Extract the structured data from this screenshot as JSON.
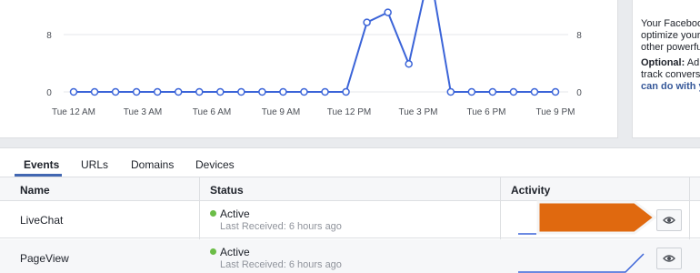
{
  "chart_data": {
    "type": "line",
    "x_ticks": [
      "Tue 12 AM",
      "Tue 3 AM",
      "Tue 6 AM",
      "Tue 9 AM",
      "Tue 12 PM",
      "Tue 3 PM",
      "Tue 6 PM",
      "Tue 9 PM"
    ],
    "y_ticks_left": [
      "8",
      "0"
    ],
    "y_ticks_right": [
      "8",
      "0"
    ],
    "ylim": [
      0,
      16
    ],
    "grid": true,
    "series": [
      {
        "color": "#3b64d8",
        "values": [
          0,
          0,
          0,
          0,
          0,
          0,
          0,
          0,
          0,
          0,
          0,
          0,
          0,
          0,
          9.7,
          11.1,
          3.9,
          17,
          0,
          0,
          0,
          0,
          0,
          0
        ]
      }
    ]
  },
  "side": {
    "lines": [
      "Your Faceboo",
      "optimize your",
      "other powerfu"
    ],
    "optional_label": "Optional:",
    "optional_rest": " Ad",
    "line5": "track conversi",
    "link": "can do with y"
  },
  "tabs": [
    {
      "label": "Events"
    },
    {
      "label": "URLs"
    },
    {
      "label": "Domains"
    },
    {
      "label": "Devices"
    }
  ],
  "columns": {
    "name": "Name",
    "status": "Status",
    "activity": "Activity"
  },
  "rows": [
    {
      "name": "LiveChat",
      "status": "Active",
      "last_received": "Last Received: 6 hours ago"
    },
    {
      "name": "PageView",
      "status": "Active",
      "last_received": "Last Received: 6 hours ago"
    }
  ],
  "colors": {
    "accent": "#4267b2",
    "line": "#3b64d8",
    "active_dot": "#6bbd47",
    "callout": "#e0690f"
  },
  "icons": {
    "view": "eye-icon"
  }
}
